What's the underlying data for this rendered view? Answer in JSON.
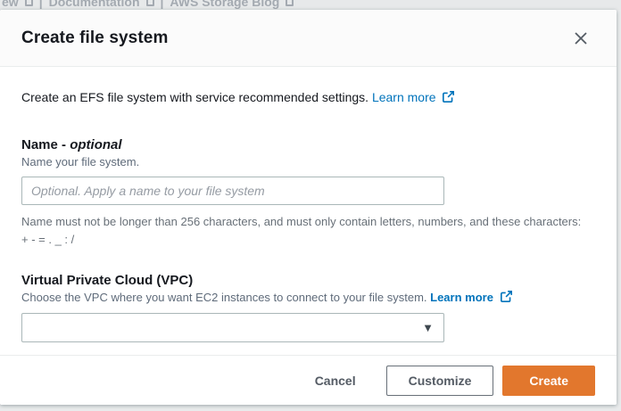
{
  "background": {
    "top_links": [
      "ew",
      "Documentation",
      "AWS Storage Blog"
    ],
    "separator": "|"
  },
  "modal": {
    "title": "Create file system",
    "intro": {
      "text": "Create an EFS file system with service recommended settings.",
      "link_label": "Learn more"
    },
    "name_section": {
      "label": "Name",
      "label_separator": " - ",
      "label_optional": "optional",
      "description": "Name your file system.",
      "input_placeholder": "Optional. Apply a name to your file system",
      "input_value": "",
      "constraint_text": "Name must not be longer than 256 characters, and must only contain letters, numbers, and these characters: + - = . _ : /"
    },
    "vpc_section": {
      "label": "Virtual Private Cloud (VPC)",
      "description": "Choose the VPC where you want EC2 instances to connect to your file system.",
      "link_label": "Learn more",
      "selected_value": ""
    },
    "footer": {
      "cancel_label": "Cancel",
      "customize_label": "Customize",
      "create_label": "Create"
    }
  },
  "icons": {
    "dropdown_caret": "▼"
  },
  "colors": {
    "accent_orange": "#e2772d",
    "link_blue": "#0073bb",
    "divider": "#eaeded",
    "input_border": "#aab7b8",
    "text_dark": "#16191f",
    "text_gray": "#687078"
  }
}
